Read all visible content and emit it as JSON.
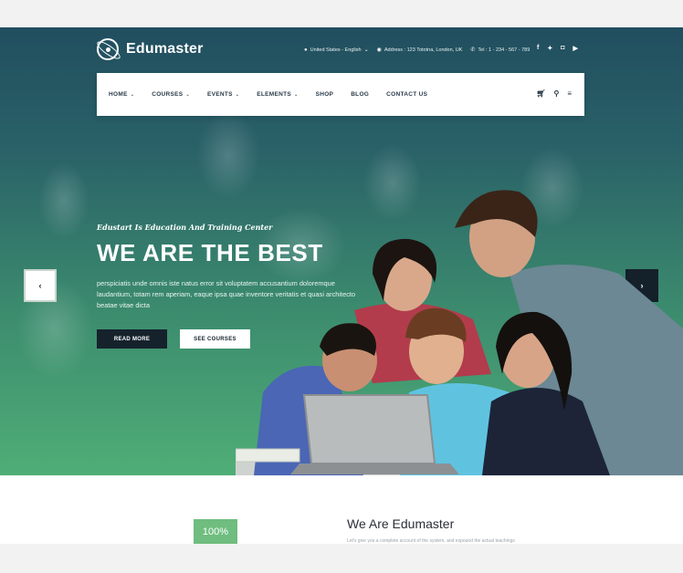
{
  "brand": {
    "name": "Edumaster"
  },
  "topbar": {
    "language": "United States - English",
    "address": "Address : 123 Tototna, London, UK",
    "phone": "Tel : 1 - 234 - 567 - 789",
    "social_icons": [
      "facebook-icon",
      "twitter-icon",
      "instagram-icon",
      "youtube-icon"
    ]
  },
  "nav": {
    "items": [
      {
        "label": "HOME",
        "dropdown": true
      },
      {
        "label": "COURSES",
        "dropdown": true
      },
      {
        "label": "EVENTS",
        "dropdown": true
      },
      {
        "label": "ELEMENTS",
        "dropdown": true
      },
      {
        "label": "SHOP",
        "dropdown": false
      },
      {
        "label": "BLOG",
        "dropdown": false
      },
      {
        "label": "CONTACT US",
        "dropdown": false
      }
    ],
    "tools": [
      "cart-icon",
      "search-icon",
      "menu-icon"
    ]
  },
  "hero": {
    "kicker": "Edustart Is Education And Training Center",
    "headline": "WE ARE THE BEST",
    "description": "perspiciatis unde omnis iste natus error sit voluptatem accusantium doloremque laudantium, totam rem aperiam, eaque ipsa quae inventore veritatis et quasi architecto beatae vitae dicta",
    "read_more": "READ MORE",
    "see_courses": "SEE COURSES",
    "prev": "‹",
    "next": "›"
  },
  "about": {
    "badge": "100%",
    "title": "We Are Edumaster",
    "text": "Let's give you a complete account of the system, and expound the actual teachings"
  },
  "colors": {
    "hero_top": "#214e5f",
    "hero_bottom": "#4fae76",
    "accent": "#6fbd7f",
    "dark": "#15222c"
  }
}
